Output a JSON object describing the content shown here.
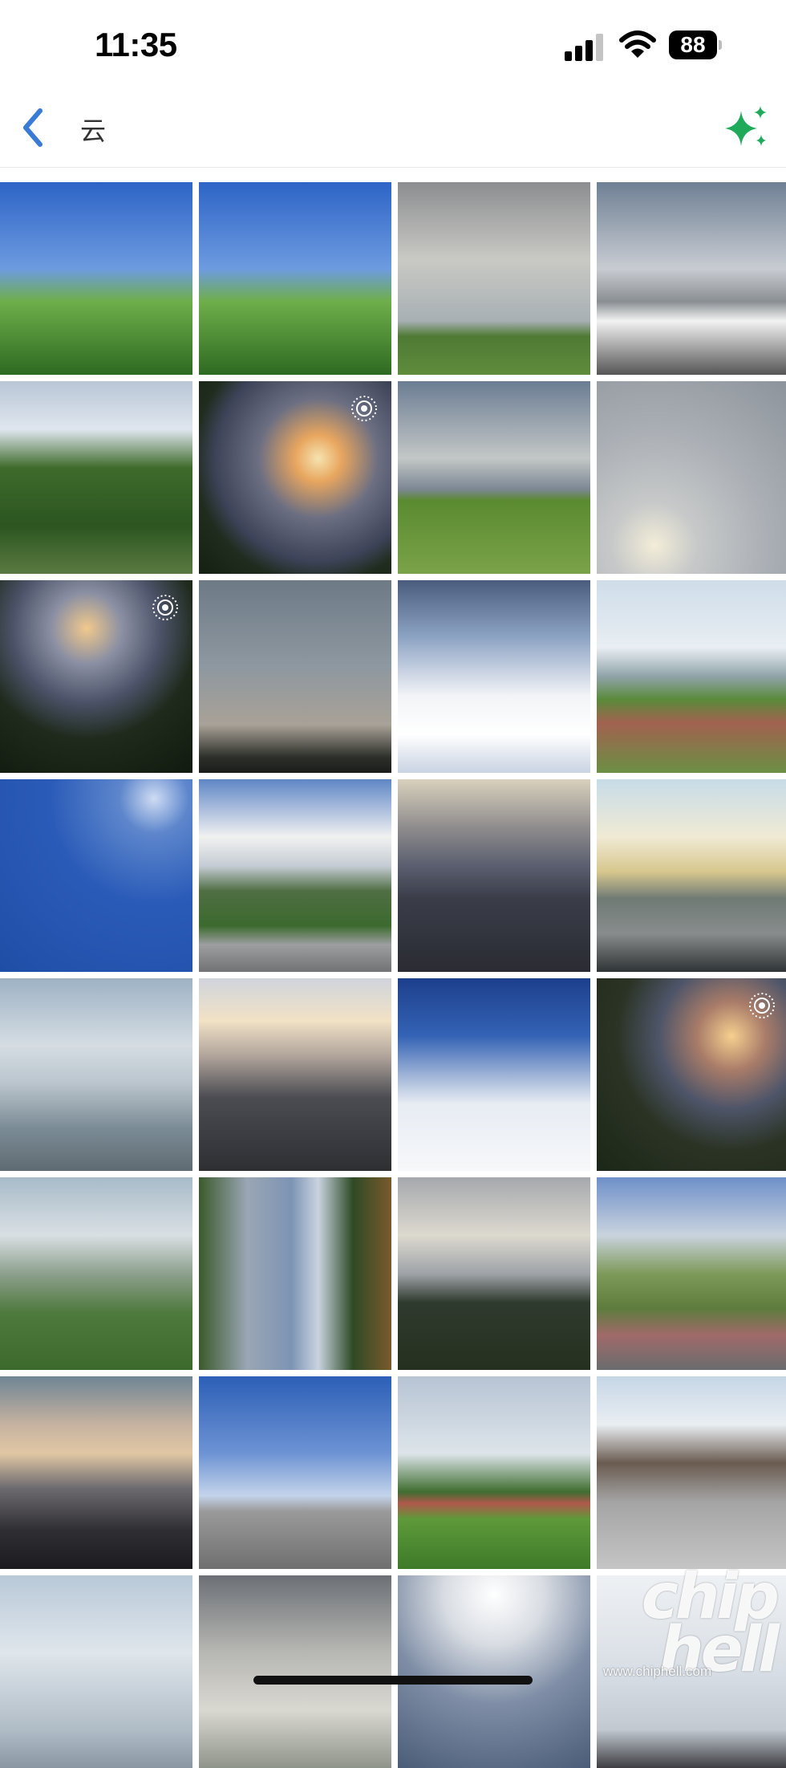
{
  "status_bar": {
    "time": "11:35",
    "battery": "88",
    "icons": [
      "signal-icon",
      "wifi-icon",
      "battery-icon"
    ]
  },
  "nav": {
    "back_icon": "chevron-left-icon",
    "title": "云",
    "action_icon": "sparkle-icon",
    "accent_color": "#3a7bd5",
    "sparkle_color": "#1faa59"
  },
  "photos": [
    {
      "scene": "trees-blue-sky",
      "live": false
    },
    {
      "scene": "trees-blue-sky",
      "live": false
    },
    {
      "scene": "overcast-field",
      "live": false
    },
    {
      "scene": "clouds-house",
      "live": false
    },
    {
      "scene": "garden-fence",
      "live": false
    },
    {
      "scene": "sunset-pylon",
      "live": true
    },
    {
      "scene": "field-city-clouds",
      "live": false
    },
    {
      "scene": "mackerel-sky",
      "live": false
    },
    {
      "scene": "dusk-pylon-trees",
      "live": true
    },
    {
      "scene": "grey-overcast",
      "live": false
    },
    {
      "scene": "clouds-from-plane",
      "live": false
    },
    {
      "scene": "city-skyline-field",
      "live": false
    },
    {
      "scene": "deep-blue-sky",
      "live": false
    },
    {
      "scene": "mountain-clouds-road",
      "live": false
    },
    {
      "scene": "dusk-building",
      "live": false
    },
    {
      "scene": "street-buildings",
      "live": false
    },
    {
      "scene": "lake-haze",
      "live": false
    },
    {
      "scene": "evening-building",
      "live": false
    },
    {
      "scene": "above-clouds",
      "live": false
    },
    {
      "scene": "sunset-billboard",
      "live": true
    },
    {
      "scene": "misty-hill",
      "live": false
    },
    {
      "scene": "skyscraper",
      "live": false
    },
    {
      "scene": "mountain-trees",
      "live": false
    },
    {
      "scene": "willow-path",
      "live": false
    },
    {
      "scene": "sunset-silhouette",
      "live": false
    },
    {
      "scene": "gravel-tents",
      "live": false
    },
    {
      "scene": "track-field",
      "live": false
    },
    {
      "scene": "old-street",
      "live": false
    },
    {
      "scene": "pale-sky",
      "live": false
    },
    {
      "scene": "grey-clouds",
      "live": false
    },
    {
      "scene": "bright-clouds",
      "live": false
    },
    {
      "scene": "tower",
      "live": false
    }
  ],
  "watermark": {
    "logo": "chip hell",
    "url": "www.chiphell.com"
  }
}
